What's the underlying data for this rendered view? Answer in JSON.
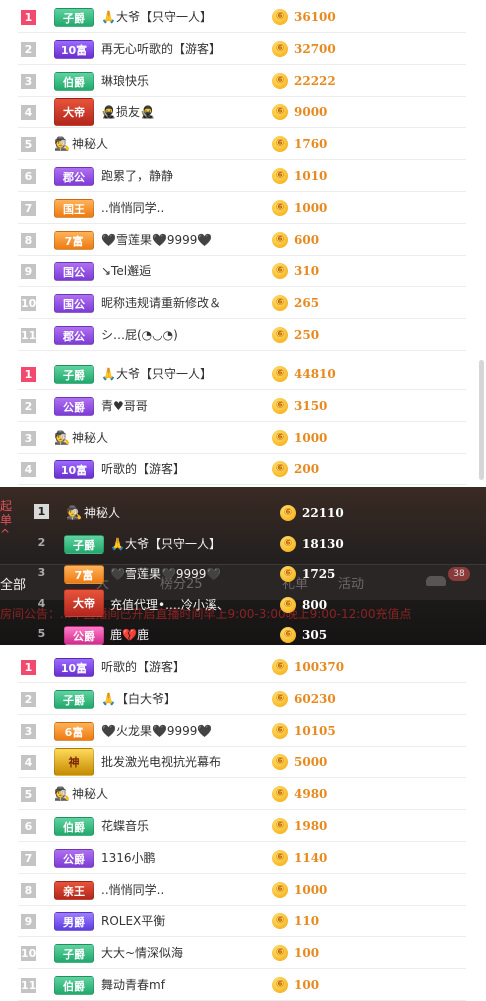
{
  "sections": [
    {
      "rows": [
        {
          "rank": "1",
          "top": true,
          "badge": "子爵",
          "badge_color": "green",
          "name": "🙏大爷【只守一人】",
          "amount": "36100"
        },
        {
          "rank": "2",
          "top": false,
          "badge": "10富",
          "badge_color": "purple",
          "name": "再无心听歌的【游客】",
          "amount": "32700"
        },
        {
          "rank": "3",
          "top": false,
          "badge": "伯爵",
          "badge_color": "green",
          "name": "琳琅快乐",
          "amount": "22222"
        },
        {
          "rank": "4",
          "top": false,
          "badge": "大帝",
          "badge_color": "red",
          "big": true,
          "name": "🥷损友🥷",
          "amount": "9000"
        },
        {
          "rank": "5",
          "top": false,
          "badge": "",
          "spy": true,
          "name": "神秘人",
          "amount": "1760"
        },
        {
          "rank": "6",
          "top": false,
          "badge": "郡公",
          "badge_color": "violet",
          "name": "跑累了，静静",
          "amount": "1010"
        },
        {
          "rank": "7",
          "top": false,
          "badge": "国王",
          "badge_color": "orange",
          "name": "..悄悄同学..",
          "amount": "1000"
        },
        {
          "rank": "8",
          "top": false,
          "badge": "7富",
          "badge_color": "orange",
          "name": "🖤雪莲果🖤9999🖤",
          "amount": "600"
        },
        {
          "rank": "9",
          "top": false,
          "badge": "国公",
          "badge_color": "violet",
          "name": "↘︎Tel邂逅",
          "amount": "310"
        },
        {
          "rank": "10",
          "top": false,
          "badge": "国公",
          "badge_color": "violet",
          "name": "昵称违规请重新修改＆",
          "amount": "265"
        },
        {
          "rank": "11",
          "top": false,
          "badge": "郡公",
          "badge_color": "violet",
          "name": "シ…屁(◔◡◔)",
          "amount": "250"
        }
      ]
    },
    {
      "rows": [
        {
          "rank": "1",
          "top": true,
          "badge": "子爵",
          "badge_color": "green",
          "name": "🙏大爷【只守一人】",
          "amount": "44810"
        },
        {
          "rank": "2",
          "top": false,
          "badge": "公爵",
          "badge_color": "violet",
          "name": "青♥哥哥",
          "amount": "3150"
        },
        {
          "rank": "3",
          "top": false,
          "badge": "",
          "spy": true,
          "name": "神秘人",
          "amount": "1000"
        },
        {
          "rank": "4",
          "top": false,
          "badge": "10富",
          "badge_color": "purple",
          "name": "听歌的【游客】",
          "amount": "200"
        }
      ]
    },
    {
      "rows": [
        {
          "rank": "1",
          "top": true,
          "badge": "10富",
          "badge_color": "purple",
          "name": "听歌的【游客】",
          "amount": "100370"
        },
        {
          "rank": "2",
          "top": false,
          "badge": "子爵",
          "badge_color": "green",
          "name": "🙏【白大爷】",
          "amount": "60230"
        },
        {
          "rank": "3",
          "top": false,
          "badge": "6富",
          "badge_color": "orange",
          "name": "🖤火龙果🖤9999🖤",
          "amount": "10105"
        },
        {
          "rank": "4",
          "top": false,
          "badge": "神",
          "badge_color": "gold",
          "big": true,
          "name": "批发激光电视抗光幕布",
          "amount": "5000"
        },
        {
          "rank": "5",
          "top": false,
          "badge": "",
          "spy": true,
          "name": "神秘人",
          "amount": "4980"
        },
        {
          "rank": "6",
          "top": false,
          "badge": "伯爵",
          "badge_color": "green",
          "name": "花蝶音乐",
          "amount": "1980"
        },
        {
          "rank": "7",
          "top": false,
          "badge": "公爵",
          "badge_color": "violet",
          "name": "1316小鹏",
          "amount": "1140"
        },
        {
          "rank": "8",
          "top": false,
          "badge": "亲王",
          "badge_color": "red",
          "name": "..悄悄同学..",
          "amount": "1000"
        },
        {
          "rank": "9",
          "top": false,
          "badge": "男爵",
          "badge_color": "blue",
          "name": "ROLEX平衡",
          "amount": "110"
        },
        {
          "rank": "10",
          "top": false,
          "badge": "子爵",
          "badge_color": "green",
          "name": "大大~情深似海",
          "amount": "100"
        },
        {
          "rank": "11",
          "top": false,
          "badge": "伯爵",
          "badge_color": "green",
          "name": "舞动青春mf",
          "amount": "100"
        }
      ]
    }
  ],
  "overlay": {
    "side_label": "起\n单\n^",
    "left_tab": "全部",
    "tabs": [
      "大",
      "榜分25",
      "礼单",
      "活动"
    ],
    "tab_badge": "38",
    "notice": "房间公告：...本直播间已开启直播时间早上9:00-3:00晚上9:00-12:00充值点",
    "rows": [
      {
        "rank": "1",
        "plain": false,
        "badge": "",
        "spy": true,
        "name": "神秘人",
        "amount": "22110"
      },
      {
        "rank": "2",
        "plain": true,
        "badge": "子爵",
        "badge_color": "green",
        "name": "🙏大爷【只守一人】",
        "amount": "18130"
      },
      {
        "rank": "3",
        "plain": true,
        "badge": "7富",
        "badge_color": "orange",
        "name": "🖤雪莲果🖤9999🖤",
        "amount": "1725"
      },
      {
        "rank": "4",
        "plain": true,
        "badge": "大帝",
        "badge_color": "red",
        "big": true,
        "name": "充值代理•.…冷小溪、",
        "amount": "800"
      },
      {
        "rank": "5",
        "plain": true,
        "badge": "公爵",
        "badge_color": "pink",
        "name": "鹿💔鹿",
        "amount": "305"
      }
    ]
  },
  "colors": {
    "accent_rank": "#f4496f",
    "amount": "#e7891e"
  }
}
